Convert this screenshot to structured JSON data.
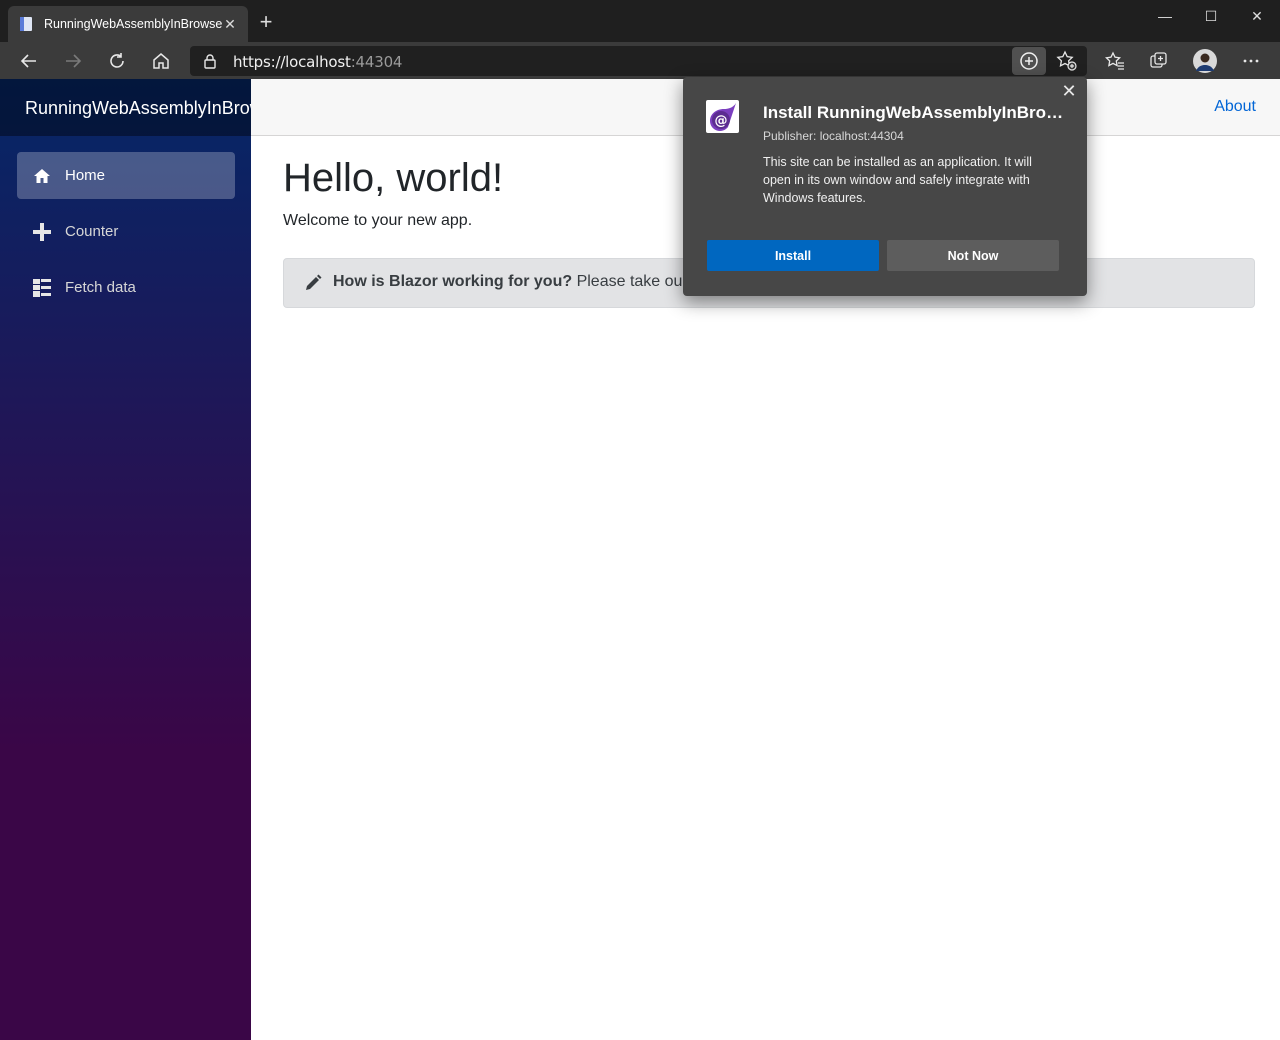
{
  "browser": {
    "tab_title": "RunningWebAssemblyInBrowser",
    "tab_close": "✕",
    "new_tab": "+",
    "url_host": "https://localhost",
    "url_port": ":44304",
    "window_controls": {
      "minimize": "—",
      "maximize": "☐",
      "close": "✕"
    },
    "icons": [
      "back-icon",
      "forward-icon",
      "refresh-icon",
      "home-icon",
      "lock-icon",
      "app-available-icon",
      "add-favorite-icon",
      "favorites-icon",
      "collections-icon",
      "profile-avatar",
      "more-icon"
    ]
  },
  "sidebar": {
    "brand": "RunningWebAssemblyInBrowser",
    "items": [
      {
        "label": "Home",
        "icon": "home-icon",
        "active": true
      },
      {
        "label": "Counter",
        "icon": "plus-icon",
        "active": false
      },
      {
        "label": "Fetch data",
        "icon": "list-icon",
        "active": false
      }
    ]
  },
  "topbar": {
    "about": "About"
  },
  "main": {
    "heading": "Hello, world!",
    "lead": "Welcome to your new app.",
    "survey_bold": "How is Blazor working for you?",
    "survey_text": " Please take our brief survey"
  },
  "install_popup": {
    "title": "Install RunningWebAssemblyInBrowser",
    "publisher": "Publisher: localhost:44304",
    "description": "This site can be installed as an application. It will open in its own window and safely integrate with Windows features.",
    "install_label": "Install",
    "not_now_label": "Not Now",
    "close": "✕"
  },
  "colors": {
    "accent": "#0067c0",
    "sidebar_top": "#052767",
    "sidebar_bottom": "#3a0647",
    "link": "#0366d6"
  }
}
